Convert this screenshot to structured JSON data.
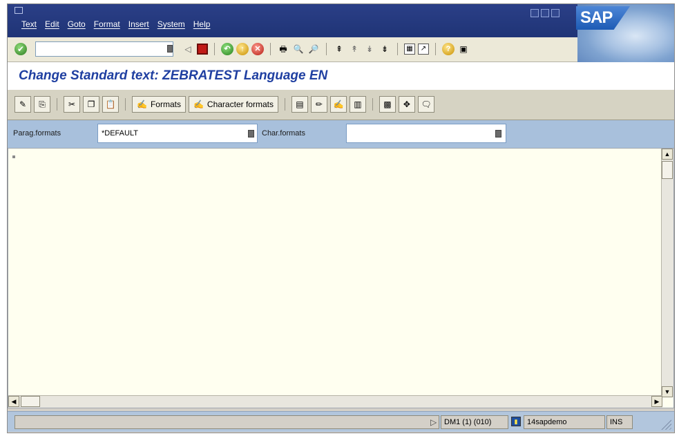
{
  "menu": {
    "items": [
      "Text",
      "Edit",
      "Goto",
      "Format",
      "Insert",
      "System",
      "Help"
    ]
  },
  "brand": {
    "logo_text": "SAP"
  },
  "command_field": {
    "value": ""
  },
  "screen": {
    "title": "Change Standard text: ZEBRATEST Language EN"
  },
  "app_toolbar": {
    "formats_label": "Formats",
    "character_formats_label": "Character formats"
  },
  "format_row": {
    "parag_label": "Parag.formats",
    "parag_value": "*DEFAULT",
    "char_label": "Char.formats",
    "char_value": ""
  },
  "status_bar": {
    "message": "",
    "system": "DM1 (1) (010)",
    "server": "14sapdemo",
    "mode": "INS"
  },
  "colors": {
    "title_bar": "#1f3476",
    "screen_title": "#1f3fa1",
    "editor_bg": "#fffff0",
    "format_row_bg": "#a8c0dc",
    "status_bar_bg": "#b2c6dd"
  }
}
